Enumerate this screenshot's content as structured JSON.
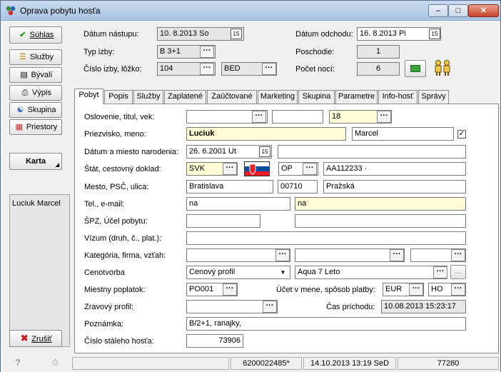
{
  "window": {
    "title": "Oprava pobytu hosťa"
  },
  "left": {
    "suhlas": "Súhlas",
    "sluzby": "Služby",
    "byvali": "Bývalí",
    "vypis": "Výpis",
    "skupina": "Skupina",
    "priestory": "Priestory",
    "karta": "Karta",
    "guest_list": [
      "Luciuk Marcel"
    ],
    "zrusit": "Zrušiť"
  },
  "header": {
    "datum_nastupu_label": "Dátum nástupu:",
    "datum_nastupu": "10. 8.2013  So",
    "typ_izby_label": "Typ izby:",
    "typ_izby": "B 3+1",
    "cislo_izby_label": "Číslo izby, lôžko:",
    "cislo_izby": "104",
    "lozko": "BED",
    "datum_odchodu_label": "Dátum odchodu:",
    "datum_odchodu": "16. 8.2013  Pi",
    "poschodie_label": "Poschodie:",
    "poschodie": "1",
    "pocet_noci_label": "Počet nocí:",
    "pocet_noci": "6"
  },
  "tabs": [
    {
      "label": "Pobyt"
    },
    {
      "label": "Popis"
    },
    {
      "label": "Služby"
    },
    {
      "label": "Zaplatené"
    },
    {
      "label": "Zaúčtované"
    },
    {
      "label": "Marketing"
    },
    {
      "label": "Skupina"
    },
    {
      "label": "Parametre"
    },
    {
      "label": "Info-hosť"
    },
    {
      "label": "Správy"
    }
  ],
  "form": {
    "oslovenie_label": "Oslovenie, titul, vek:",
    "vek": "18",
    "priezvisko_label": "Priezvisko, meno:",
    "priezvisko": "Luciuk",
    "meno": "Marcel",
    "narodenie_label": "Dátum a miesto narodenia:",
    "datum_narodenia": "26. 6.2001  Ut",
    "stat_label": "Štát, cestovný doklad:",
    "stat": "SVK",
    "doklad_typ": "OP",
    "doklad_cislo": "AA112233   ·",
    "mesto_label": "Mesto, PSČ, ulica:",
    "mesto": "Bratislava",
    "psc": "00710",
    "ulica": "Pražská",
    "tel_label": "Tel., e-mail:",
    "tel": "na",
    "email": "na",
    "spz_label": "ŠPZ, Účel pobytu:",
    "vizum_label": "Vízum (druh, č., plat.):",
    "kategoria_label": "Kategória, firma, vzťah:",
    "cenotvorba_label": "Cenotvorba",
    "cenotvorba": "Cenový profil",
    "cenovy_profil": "Aqua 7 Leto",
    "poplatok_label": "Miestny poplatok:",
    "poplatok": "PO001",
    "ucet_label": "Účet v mene, spôsob platby:",
    "mena": "EUR",
    "platba": "HO",
    "zdravotny_label": "Zravový profil:",
    "cas_prichodu_label": "Čas príchodu:",
    "cas_prichodu": "10.08.2013 15:23:17",
    "poznamka_label": "Poznámka:",
    "poznamka": "B/2+1, ranajky,",
    "cislo_hosta_label": "Číslo stáleho hosťa:",
    "cislo_hosta": "73906"
  },
  "status": {
    "code": "6200022485*",
    "datetime": "14.10.2013 13:19 SeD",
    "number": "77280"
  }
}
